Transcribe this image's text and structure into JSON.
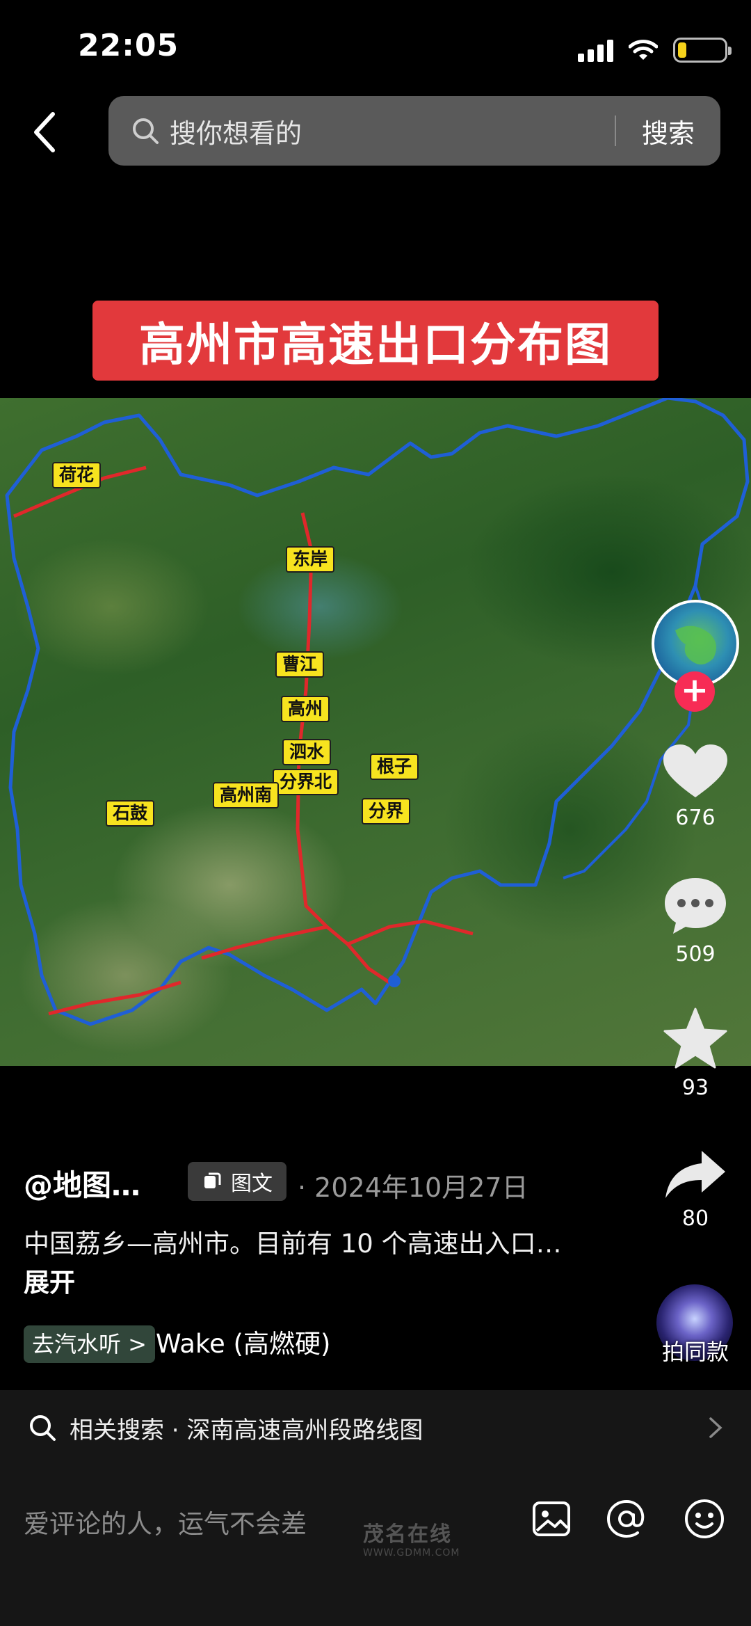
{
  "status_bar": {
    "time": "22:05"
  },
  "header": {
    "search_placeholder": "搜你想看的",
    "search_button": "搜索"
  },
  "post": {
    "title_banner": "高州市高速出口分布图",
    "map_labels": {
      "hehua": "荷花",
      "dongan": "东岸",
      "caojiang": "曹江",
      "gaozhou": "高州",
      "sishui": "泗水",
      "genzi": "根子",
      "fenjiebei": "分界北",
      "gaozhounan": "高州南",
      "fenjie": "分界",
      "shigu": "石鼓"
    },
    "author": "@地图…",
    "type_label": "图文",
    "date": "2024年10月27日",
    "description": "中国荔乡—高州市。目前有 10 个高速出入口…",
    "expand_label": "展开",
    "music_link": "去汽水听 >",
    "music_name": "Wake (高燃硬)"
  },
  "actions": {
    "likes": "676",
    "comments": "509",
    "favorites": "93",
    "shares": "80",
    "same_style": "拍同款"
  },
  "related_search": {
    "text": "相关搜索 · 深南高速高州段路线图"
  },
  "comment_bar": {
    "placeholder": "爱评论的人，运气不会差"
  },
  "watermark": {
    "name": "茂名在线",
    "url": "WWW.GDMM.COM"
  },
  "colors": {
    "banner_red": "#e2393c",
    "road_red": "#e0282b",
    "boundary_blue": "#1f5fd6",
    "label_yellow": "#f7e31f",
    "follow_pink": "#f72c55"
  }
}
